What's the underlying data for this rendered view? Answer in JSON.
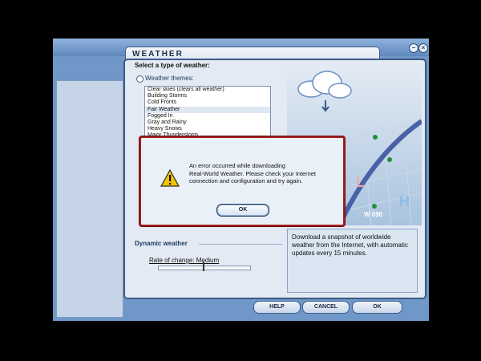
{
  "window": {
    "title": "WEATHER"
  },
  "weather_type": {
    "heading": "Select a type of weather:",
    "themes_label": "Weather themes:",
    "themes": [
      "Clear skies (clears all weather)",
      "Building Storms",
      "Cold Fronts",
      "Fair Weather",
      "Fogged In",
      "Gray and Rainy",
      "Heavy Snows",
      "Major Thunderstorm"
    ],
    "selected_theme": "Fair Weather"
  },
  "dynamic": {
    "label": "Dynamic weather",
    "rate_label": "Rate of change: Medium",
    "rate_level": 0.5
  },
  "description": "Download a snapshot of worldwide weather from the Internet, with automatic updates every 15 minutes.",
  "preview": {
    "letter_l": "L",
    "letter_h": "H",
    "temp_text": "W 090"
  },
  "buttons": {
    "help": "HELP",
    "cancel": "CANCEL",
    "ok": "OK"
  },
  "error_dialog": {
    "line1": "An error occurred while downloading",
    "line2": "Real-World Weather. Please check your Internet",
    "line3": "connection and configuration and try again.",
    "ok": "OK"
  },
  "colors": {
    "dialog_border": "#a11f1f",
    "accent": "#3b5a83"
  }
}
